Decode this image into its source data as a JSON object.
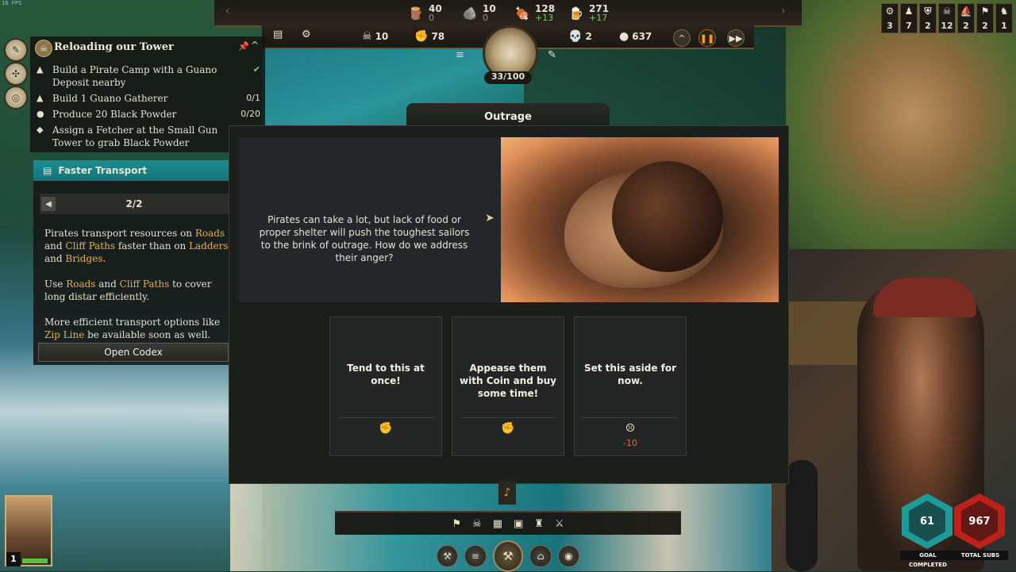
{
  "fps": "18 FPS",
  "resources": [
    {
      "icon": "wood-icon",
      "glyph": "🪵",
      "value": "40",
      "sub": "0",
      "positive": false
    },
    {
      "icon": "stone-icon",
      "glyph": "🪨",
      "value": "10",
      "sub": "0",
      "positive": false
    },
    {
      "icon": "food-icon",
      "glyph": "🍖",
      "value": "128",
      "sub": "+13",
      "positive": true
    },
    {
      "icon": "rum-icon",
      "glyph": "🍺",
      "value": "271",
      "sub": "+17",
      "positive": true
    }
  ],
  "stats": [
    {
      "icon": "pirates-icon",
      "glyph": "☠",
      "value": "10"
    },
    {
      "icon": "morale-icon",
      "glyph": "✊",
      "value": "78"
    },
    {
      "icon": "infamy-icon",
      "glyph": "💀",
      "value": "2"
    },
    {
      "icon": "coin-icon",
      "glyph": "●",
      "value": "637"
    }
  ],
  "medallion_count": "33/100",
  "corner_counters": [
    {
      "icon": "gear-icon",
      "glyph": "⚙",
      "value": "3"
    },
    {
      "icon": "crew-icon",
      "glyph": "♟",
      "value": "7"
    },
    {
      "icon": "shield-icon",
      "glyph": "⛨",
      "value": "2"
    },
    {
      "icon": "pirate-skull-icon",
      "glyph": "☠",
      "value": "12"
    },
    {
      "icon": "ship-icon",
      "glyph": "⛵",
      "value": "2"
    },
    {
      "icon": "flag-icon",
      "glyph": "⚑",
      "value": "2"
    },
    {
      "icon": "parrot-icon",
      "glyph": "♞",
      "value": "1"
    }
  ],
  "quest": {
    "title": "Reloading our Tower",
    "rows": [
      {
        "icon": "sack-icon",
        "glyph": "▲",
        "text": "Build a Pirate Camp with a Guano Deposit nearby",
        "progress": "",
        "done": true
      },
      {
        "icon": "sack-icon",
        "glyph": "▲",
        "text": "Build 1 Guano Gatherer",
        "progress": "0/1",
        "done": false
      },
      {
        "icon": "powder-icon",
        "glyph": "●",
        "text": "Produce 20 Black Powder",
        "progress": "0/20",
        "done": false
      },
      {
        "icon": "diamond-icon",
        "glyph": "◆",
        "text": "Assign a Fetcher at the  Small Gun Tower to grab  Black Powder",
        "progress": "",
        "done": false
      }
    ]
  },
  "tips": {
    "title": "Faster Transport",
    "page": "2/2",
    "open_codex": "Open Codex",
    "p1": [
      "Pirates transport resources on ",
      "Roads",
      " and ",
      "Cliff Paths",
      " faster than on ",
      "Ladders",
      " and ",
      "Bridges",
      "."
    ],
    "p2": [
      "Use ",
      "Roads",
      " and ",
      "Cliff Paths",
      " to cover long distar efficiently."
    ],
    "p3": [
      "More efficient transport options like ",
      "Zip Line",
      " be available soon as well."
    ]
  },
  "event": {
    "title": "Outrage",
    "text": "Pirates can take a lot, but lack of food or proper shelter will push the toughest sailors to the brink of outrage. How do we address their anger?",
    "options": [
      {
        "label": "Tend to this at once!",
        "icon": "fist-icon",
        "glyph": "✊",
        "cost": ""
      },
      {
        "label": "Appease them with Coin and buy some time!",
        "icon": "fist-icon",
        "glyph": "✊",
        "cost": ""
      },
      {
        "label": "Set this aside for now.",
        "icon": "morale-icon",
        "glyph": "☹",
        "cost": "-10"
      }
    ]
  },
  "bottom_tools": [
    {
      "icon": "flag-tool-icon",
      "glyph": "⚑"
    },
    {
      "icon": "crew-tool-icon",
      "glyph": "☠"
    },
    {
      "icon": "storage-tool-icon",
      "glyph": "▦"
    },
    {
      "icon": "chest-tool-icon",
      "glyph": "▣"
    },
    {
      "icon": "bottle-tool-icon",
      "glyph": "♜"
    },
    {
      "icon": "cannon-tool-icon",
      "glyph": "⚔"
    }
  ],
  "build_tools": [
    {
      "icon": "axe-icon",
      "glyph": "⚒"
    },
    {
      "icon": "scroll-icon",
      "glyph": "≡"
    },
    {
      "icon": "hammer-icon",
      "glyph": "⚒"
    },
    {
      "icon": "building-icon",
      "glyph": "⌂"
    },
    {
      "icon": "eye-icon",
      "glyph": "◉"
    }
  ],
  "character": {
    "level": "1",
    "health": 0.9
  },
  "stream": {
    "goal_value": "61",
    "goal_label": "GOAL COMPLETED",
    "subs_value": "967",
    "subs_label": "TOTAL SUBS"
  },
  "colors": {
    "accent_teal": "#1b8e92",
    "highlight": "#d9b25a",
    "cost_red": "#e06a3a"
  }
}
